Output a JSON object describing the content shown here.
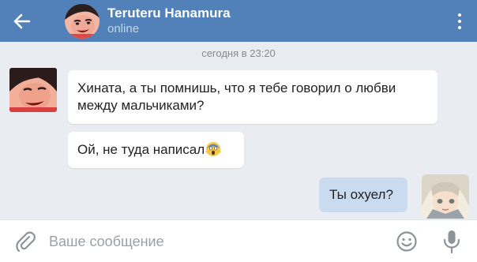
{
  "header": {
    "contact_name": "Teruteru Hanamura",
    "status": "online",
    "back_icon": "back-arrow-icon",
    "more_icon": "more-vertical-icon",
    "bg_color": "#5181b8"
  },
  "chat": {
    "date_label": "сегодня в 23:20",
    "messages": [
      {
        "direction": "incoming",
        "text": "Хината, а ты помнишь, что я тебе говорил о любви между мальчиками?"
      },
      {
        "direction": "incoming",
        "text": "Ой, не туда написал",
        "emoji": "face-screaming-in-fear"
      },
      {
        "direction": "outgoing",
        "text": "Ты охуел?"
      }
    ]
  },
  "composer": {
    "placeholder": "Ваше сообщение",
    "value": "",
    "attach_icon": "paperclip-icon",
    "emoji_icon": "smiley-icon",
    "mic_icon": "microphone-icon"
  }
}
